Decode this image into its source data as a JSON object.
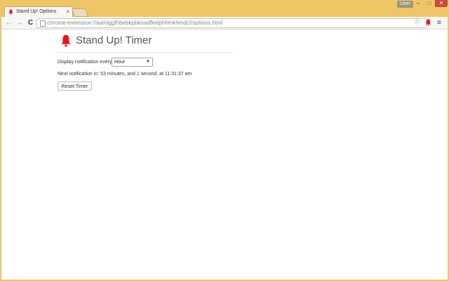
{
  "window": {
    "user_badge": "User",
    "minimize": "–",
    "maximize": "□",
    "close": "✕"
  },
  "tab": {
    "title": "Stand Up! Options",
    "close": "×"
  },
  "toolbar": {
    "back": "←",
    "forward": "→",
    "reload": "C",
    "url": "chrome-extension://aamiggfhbebkpbknadfkelphhmkhmdcf/options.html",
    "star": "☆",
    "menu": "≡"
  },
  "page": {
    "title": "Stand Up! Timer",
    "display_label": "Display notification every:",
    "interval_value": "Hour",
    "select_arrow": "▼",
    "next_notification": "Next notification in: 53 minutes, and 1 second, at 11:31:37 am",
    "reset_button": "Reset Timer"
  },
  "colors": {
    "bell": "#e8141b",
    "window_frame": "#eec665"
  }
}
